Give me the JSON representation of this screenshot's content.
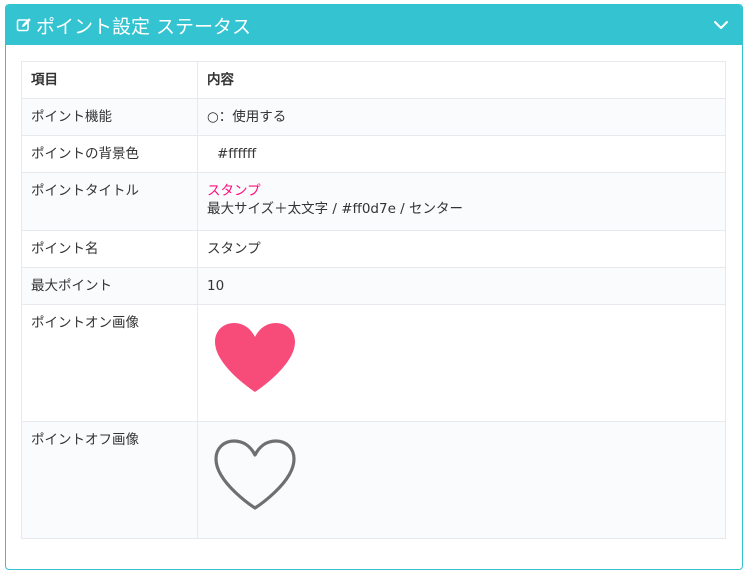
{
  "panel": {
    "title": "ポイント設定 ステータス",
    "header_color": "#33c3d1",
    "edit_icon": "edit-icon",
    "collapse_icon": "chevron-down-icon"
  },
  "table": {
    "headers": [
      "項目",
      "内容"
    ],
    "rows": {
      "feature": {
        "label": "ポイント機能",
        "value": "○：使用する"
      },
      "bgcolor": {
        "label": "ポイントの背景色",
        "value": "#ffffff"
      },
      "title": {
        "label": "ポイントタイトル",
        "value": "スタンプ",
        "detail": "最大サイズ＋太文字 / #ff0d7e / センター",
        "color": "#ff0d7e"
      },
      "name": {
        "label": "ポイント名",
        "value": "スタンプ"
      },
      "max": {
        "label": "最大ポイント",
        "value": "10"
      },
      "on_image": {
        "label": "ポイントオン画像",
        "image": "heart-filled-icon",
        "color": "#f74b7a"
      },
      "off_image": {
        "label": "ポイントオフ画像",
        "image": "heart-outline-icon",
        "color": "#6f6f6f"
      }
    }
  }
}
